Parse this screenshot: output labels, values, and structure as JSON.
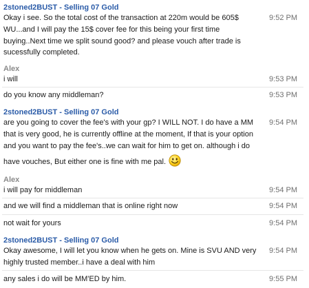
{
  "messages": [
    {
      "sender": "2stoned2BUST - Selling 07 Gold",
      "time": "9:52 PM",
      "lines": [
        "Okay i see. So the total cost of the transaction at 220m would be 605$",
        "WU...and I will pay the 15$ cover fee for this being your first time",
        "buying..Next time we split sound good? and please vouch after trade is",
        "sucessfully completed."
      ]
    },
    {
      "sender": "Alex",
      "lines": [
        "i will"
      ],
      "time": "9:53 PM"
    },
    {
      "text": "do you know any middleman?",
      "time": "9:53 PM"
    },
    {
      "sender": "2stoned2BUST - Selling 07 Gold",
      "time": "9:54 PM",
      "lines": [
        "are you going to cover the fee's with your gp? I WILL NOT. I do have a MM",
        "that is very good, he is currently offline at the moment, If that is your option",
        "and you want to pay the fee's..we can wait for him to get on. although i do",
        "have vouches, But either one is fine with me pal."
      ],
      "emoticon": "smiley-icon"
    },
    {
      "sender": "Alex",
      "lines": [
        "i will pay for middleman"
      ],
      "time": "9:54 PM"
    },
    {
      "text": "and we will find a middleman that is online right now",
      "time": "9:54 PM"
    },
    {
      "text": "not wait for yours",
      "time": "9:54 PM"
    },
    {
      "sender": "2stoned2BUST - Selling 07 Gold",
      "time": "9:54 PM",
      "lines": [
        "Okay awesome, I will let you know when he gets on. Mine is SVU AND very",
        "highly trusted member..i have a deal with him"
      ]
    },
    {
      "text": "any sales i do will be MM'ED by him.",
      "time": "9:55 PM"
    }
  ],
  "colors": {
    "seller_name": "#2a5ba8",
    "buyer_name": "#8a8a8a",
    "text": "#1a1a1a",
    "time": "#6f6f6f"
  }
}
